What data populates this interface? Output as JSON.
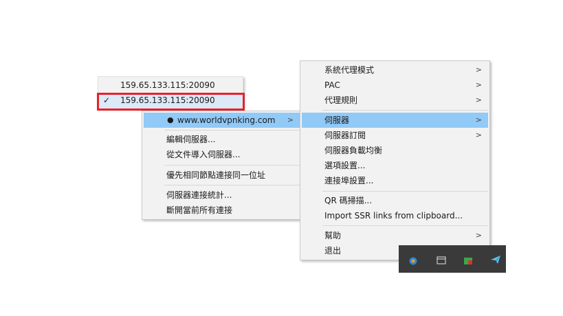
{
  "main_menu": {
    "items": [
      {
        "label": "系統代理模式",
        "submenu": true
      },
      {
        "label": "PAC",
        "submenu": true
      },
      {
        "label": "代理規則",
        "submenu": true
      },
      {
        "label": "伺服器",
        "submenu": true,
        "highlighted": true
      },
      {
        "label": "伺服器訂閱",
        "submenu": true
      },
      {
        "label": "伺服器負載均衡",
        "submenu": false
      },
      {
        "label": "選項設置...",
        "submenu": false
      },
      {
        "label": "連接埠設置...",
        "submenu": false
      },
      {
        "label": "QR 碼掃描...",
        "submenu": false
      },
      {
        "label": "Import SSR links from clipboard...",
        "submenu": false
      },
      {
        "label": "幫助",
        "submenu": true
      },
      {
        "label": "退出",
        "submenu": false
      }
    ]
  },
  "servers_menu": {
    "items": [
      {
        "label": "www.worldvpnking.com",
        "submenu": true,
        "highlighted": true,
        "bullet": "●"
      },
      {
        "label": "編輯伺服器..."
      },
      {
        "label": "從文件導入伺服器..."
      },
      {
        "label": "優先相同節點連接同一位址"
      },
      {
        "label": "伺服器連接統計..."
      },
      {
        "label": "斷開當前所有連接"
      }
    ]
  },
  "recent_menu": {
    "items": [
      {
        "label": "159.65.133.115:20090",
        "checked": false
      },
      {
        "label": "159.65.133.115:20090",
        "checked": true
      }
    ]
  },
  "icons": {
    "submenu_arrow": "chevron-right-icon",
    "check": "check-icon"
  },
  "colors": {
    "highlight": "#91c9f7",
    "annotation": "#e8202a",
    "taskbar": "#3a3a3a"
  }
}
